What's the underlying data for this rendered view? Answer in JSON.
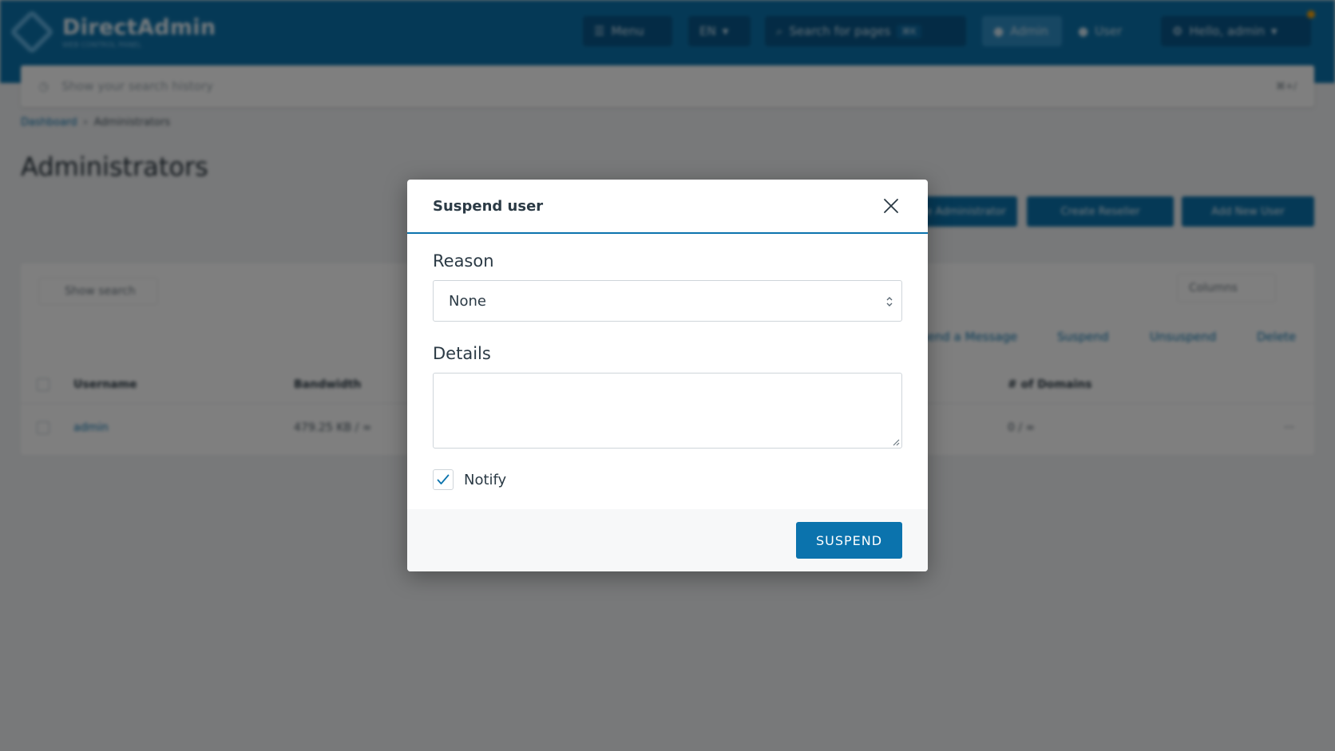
{
  "app": {
    "brand_name": "DirectAdmin",
    "brand_sub": "WEB CONTROL PANEL"
  },
  "topbar": {
    "menu_label": "Menu",
    "lang_label": "EN",
    "search_label": "Search for pages",
    "search_kbd": "⌘K",
    "admin_tab": "Admin",
    "user_tab": "User",
    "profile_label": "Hello, admin",
    "notification_color": "#f2a20c"
  },
  "searchbar": {
    "placeholder": "Show your search history",
    "shortcut": "⌘+/"
  },
  "breadcrumb": {
    "home": "Dashboard",
    "current": "Administrators"
  },
  "page": {
    "title": "Administrators",
    "buttons": [
      "Create Administrator",
      "Create Reseller",
      "Add New User"
    ],
    "show_search": "Show search",
    "columns_btn": "Columns",
    "actions": [
      "Send a Message",
      "Suspend",
      "Unsuspend",
      "Delete"
    ],
    "table": {
      "headers": [
        "Username",
        "Bandwidth",
        "# of Domains"
      ],
      "rows": [
        {
          "username": "admin",
          "bandwidth": "479.25 KB / ∞",
          "domains": "0 / ∞"
        }
      ]
    }
  },
  "modal": {
    "title": "Suspend user",
    "reason_label": "Reason",
    "reason_value": "None",
    "details_label": "Details",
    "details_value": "",
    "notify_label": "Notify",
    "notify_checked": true,
    "submit_label": "SUSPEND",
    "accent_color": "#0b73ad"
  }
}
